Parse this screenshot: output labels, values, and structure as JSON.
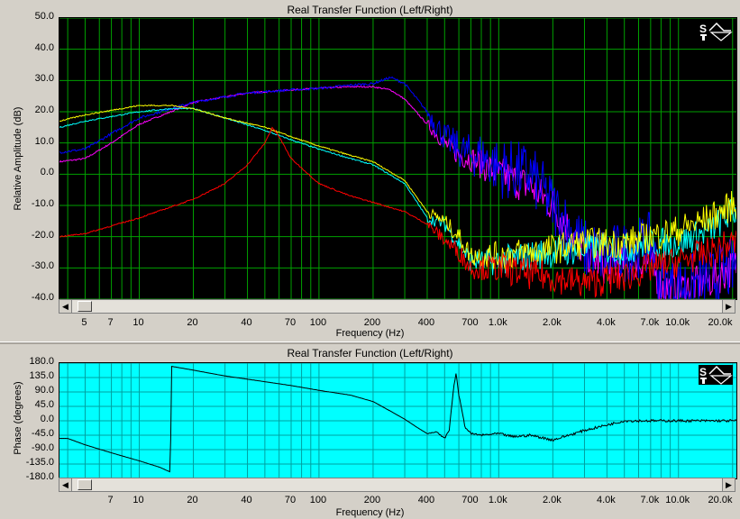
{
  "chart_data": [
    {
      "type": "line",
      "title": "Real Transfer Function (Left/Right)",
      "xlabel": "Frequency (Hz)",
      "ylabel": "Relative Amplitude (dB)",
      "xscale": "log",
      "xlim": [
        3.6,
        21000
      ],
      "ylim": [
        -40,
        50
      ],
      "yticks": [
        "50.0",
        "40.0",
        "30.0",
        "20.0",
        "10.0",
        "0.0",
        "-10.0",
        "-20.0",
        "-30.0",
        "-40.0"
      ],
      "xticks": [
        {
          "f": 5,
          "label": "5"
        },
        {
          "f": 7,
          "label": "7"
        },
        {
          "f": 10,
          "label": "10"
        },
        {
          "f": 20,
          "label": "20"
        },
        {
          "f": 40,
          "label": "40"
        },
        {
          "f": 70,
          "label": "70"
        },
        {
          "f": 100,
          "label": "100"
        },
        {
          "f": 200,
          "label": "200"
        },
        {
          "f": 400,
          "label": "400"
        },
        {
          "f": 700,
          "label": "700"
        },
        {
          "f": 1000,
          "label": "1.0k"
        },
        {
          "f": 2000,
          "label": "2.0k"
        },
        {
          "f": 4000,
          "label": "4.0k"
        },
        {
          "f": 7000,
          "label": "7.0k"
        },
        {
          "f": 10000,
          "label": "10.0k"
        },
        {
          "f": 20000,
          "label": "20.0k"
        }
      ],
      "grid": true,
      "background": "#000000",
      "grid_color": "#00a000",
      "series": [
        {
          "color": "#ff00ff",
          "noise": 6,
          "x": [
            3.6,
            5,
            7,
            10,
            15,
            20,
            40,
            70,
            100,
            150,
            200,
            250,
            300,
            400,
            500,
            600,
            700,
            800,
            1000,
            1500,
            2000,
            3000,
            4000,
            5000,
            7000,
            8000,
            10000,
            15000,
            20000,
            21000
          ],
          "y": [
            4,
            5,
            10,
            16,
            20,
            23,
            26,
            27,
            27.5,
            28,
            28,
            27,
            24,
            16,
            10,
            6,
            5,
            3,
            0,
            -4,
            -10,
            -25,
            -30,
            -28,
            -28,
            -36,
            -37,
            -34,
            -30,
            -29
          ]
        },
        {
          "color": "#0000ff",
          "noise": 10,
          "x": [
            3.6,
            5,
            7,
            10,
            15,
            20,
            40,
            70,
            100,
            150,
            200,
            250,
            300,
            400,
            500,
            600,
            700,
            800,
            1000,
            1500,
            2000,
            3000,
            4000,
            5000,
            7000,
            8000,
            10000,
            15000,
            20000,
            21000
          ],
          "y": [
            7,
            8,
            13,
            18,
            21,
            23,
            26,
            27,
            27.5,
            28.5,
            29,
            31,
            29,
            20,
            12,
            8,
            6,
            6,
            2,
            0,
            -10,
            -24,
            -26,
            -25,
            -22,
            -35,
            -36,
            -34,
            -30,
            -29
          ]
        },
        {
          "color": "#00ffff",
          "noise": 5,
          "x": [
            3.6,
            5,
            10,
            15,
            20,
            30,
            50,
            70,
            100,
            150,
            200,
            300,
            400,
            500,
            600,
            700,
            1000,
            1500,
            2000,
            3000,
            5000,
            7000,
            10000,
            15000,
            20000,
            21000
          ],
          "y": [
            15,
            17,
            20,
            21,
            21,
            18,
            14,
            11,
            8,
            5,
            3,
            -3,
            -14,
            -16,
            -22,
            -28,
            -28,
            -26,
            -25,
            -24,
            -24,
            -22,
            -22,
            -18,
            -12,
            -12
          ]
        },
        {
          "color": "#ffff00",
          "noise": 5,
          "x": [
            3.6,
            5,
            10,
            15,
            20,
            30,
            50,
            70,
            100,
            150,
            200,
            300,
            400,
            500,
            600,
            700,
            1000,
            1500,
            2000,
            3000,
            5000,
            7000,
            10000,
            15000,
            20000,
            21000
          ],
          "y": [
            17,
            19,
            22,
            22,
            21,
            18,
            15,
            12,
            9,
            6,
            4,
            -2,
            -12,
            -15,
            -20,
            -26,
            -26,
            -25,
            -24,
            -22,
            -22,
            -20,
            -18,
            -14,
            -10,
            -10
          ]
        },
        {
          "color": "#ff0000",
          "noise": 5,
          "x": [
            3.6,
            5,
            10,
            20,
            30,
            40,
            50,
            55,
            60,
            70,
            100,
            150,
            200,
            300,
            400,
            500,
            600,
            700,
            1000,
            1500,
            2000,
            3000,
            5000,
            7000,
            10000,
            15000,
            20000,
            21000
          ],
          "y": [
            -20,
            -19,
            -14,
            -8,
            -3,
            3,
            10,
            15,
            12,
            5,
            -3,
            -7,
            -9,
            -12,
            -16,
            -21,
            -25,
            -30,
            -30,
            -32,
            -33,
            -35,
            -33,
            -30,
            -28,
            -25,
            -22,
            -22
          ]
        }
      ]
    },
    {
      "type": "line",
      "title": "Real Transfer Function (Left/Right)",
      "xlabel": "Frequency (Hz)",
      "ylabel": "Phase (degrees)",
      "xscale": "log",
      "xlim": [
        3.6,
        21000
      ],
      "ylim": [
        -180,
        180
      ],
      "yticks": [
        "180.0",
        "135.0",
        "90.0",
        "45.0",
        "0.0",
        "-45.0",
        "-90.0",
        "-135.0",
        "-180.0"
      ],
      "xticks": [
        {
          "f": 7,
          "label": "7"
        },
        {
          "f": 10,
          "label": "10"
        },
        {
          "f": 20,
          "label": "20"
        },
        {
          "f": 40,
          "label": "40"
        },
        {
          "f": 70,
          "label": "70"
        },
        {
          "f": 100,
          "label": "100"
        },
        {
          "f": 200,
          "label": "200"
        },
        {
          "f": 400,
          "label": "400"
        },
        {
          "f": 700,
          "label": "700"
        },
        {
          "f": 1000,
          "label": "1.0k"
        },
        {
          "f": 2000,
          "label": "2.0k"
        },
        {
          "f": 4000,
          "label": "4.0k"
        },
        {
          "f": 7000,
          "label": "7.0k"
        },
        {
          "f": 10000,
          "label": "10.0k"
        },
        {
          "f": 20000,
          "label": "20.0k"
        }
      ],
      "grid": true,
      "background": "#00ffff",
      "grid_color": "#00a0a0",
      "series": [
        {
          "color": "#000000",
          "noise": 4,
          "x": [
            3.6,
            4,
            5,
            7,
            10,
            13,
            14.9,
            15.1,
            17,
            20,
            30,
            50,
            70,
            100,
            150,
            200,
            250,
            300,
            350,
            400,
            450,
            500,
            530,
            560,
            580,
            600,
            650,
            700,
            800,
            1000,
            1200,
            1500,
            2000,
            3000,
            5000,
            10000,
            21000
          ],
          "y": [
            -55,
            -55,
            -75,
            -100,
            -125,
            -145,
            -160,
            170,
            165,
            158,
            140,
            122,
            110,
            95,
            80,
            60,
            30,
            5,
            -20,
            -40,
            -35,
            -55,
            -30,
            100,
            150,
            80,
            -20,
            -40,
            -45,
            -40,
            -50,
            -45,
            -60,
            -30,
            0,
            0,
            0
          ]
        }
      ]
    }
  ]
}
